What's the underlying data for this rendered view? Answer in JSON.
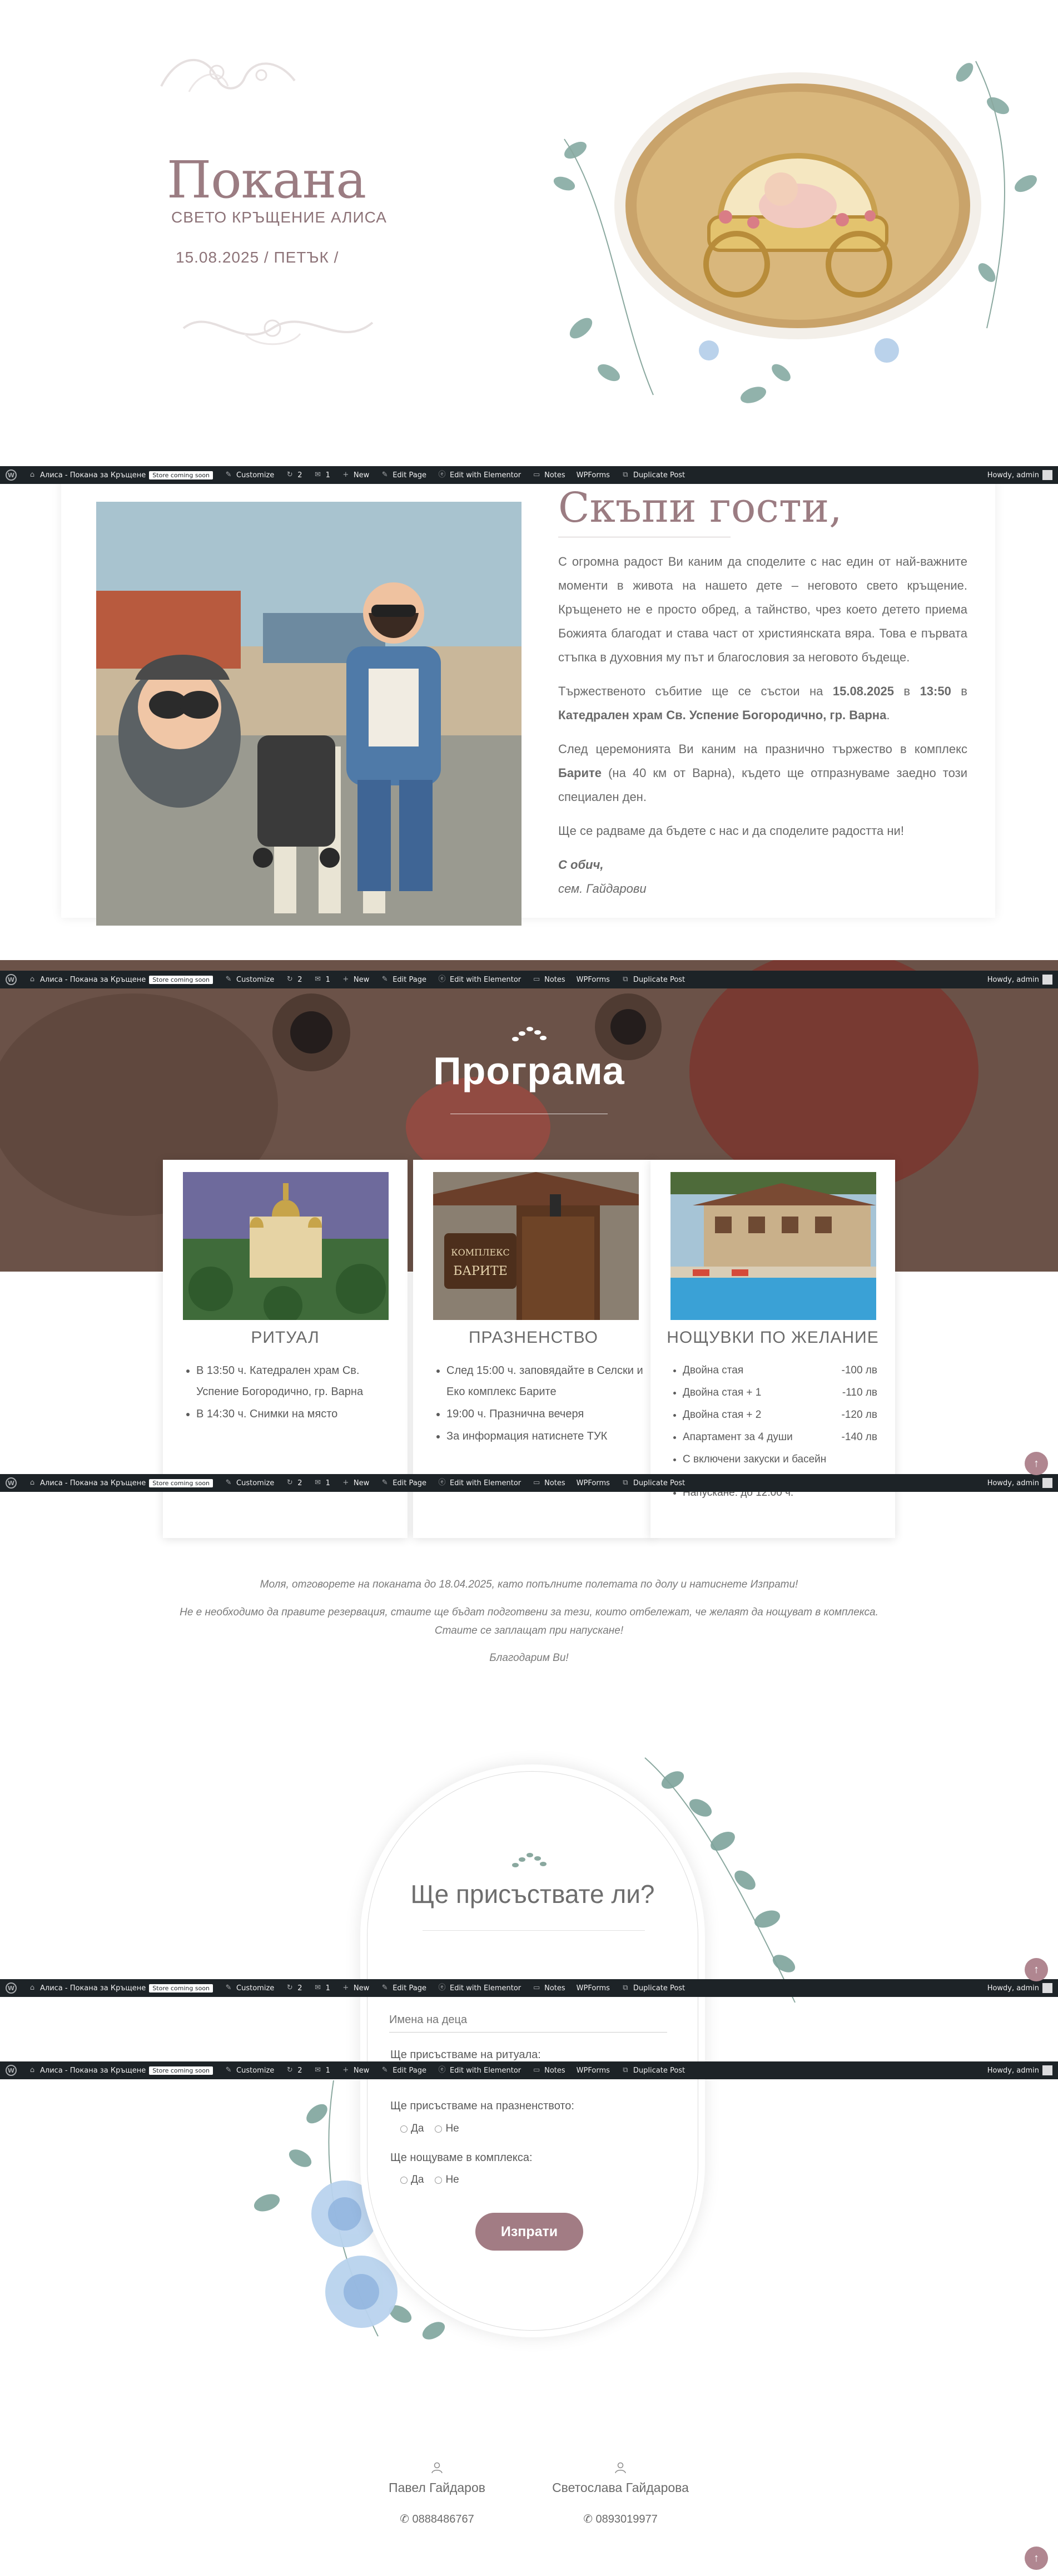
{
  "adminbar": {
    "site_name": "Алиса - Покана за Кръщене",
    "badge": "Store coming soon",
    "customize": "Customize",
    "updates": "2",
    "comments": "1",
    "new": "New",
    "edit_page": "Edit Page",
    "edit_elementor": "Edit with Elementor",
    "notes": "Notes",
    "wpforms": "WPForms",
    "duplicate": "Duplicate Post",
    "howdy": "Howdy, admin"
  },
  "hero": {
    "title": "Покана",
    "subtitle": "СВЕТО КРЪЩЕНИЕ АЛИСА",
    "date": "15.08.2025 / ПЕТЪК /"
  },
  "invite": {
    "title": "Скъпи гости,",
    "p1": "С огромна радост Ви каним да споделите с нас един от най-важните моменти в живота на нашето дете – неговото свето кръщение. Кръщенето не е просто обред, а тайнство, чрез което детето приема Божията благодат и става част от християнската вяра. Това е първата стъпка в духовния му път и благословия за неговото бъдеще.",
    "p2_a": "Тържественото събитие ще се състои на ",
    "p2_date": "15.08.2025",
    "p2_b": " в ",
    "p2_time": "13:50",
    "p2_c": " в ",
    "p2_place": "Катедрален храм Св. Успение Богородично, гр. Варна",
    "p2_d": ".",
    "p3_a": "След церемонията Ви каним на празнично тържество в комплекс ",
    "p3_place": "Барите",
    "p3_b": " (на 40 км от Варна), където ще отпразнуваме заедно този специален ден.",
    "p4": "Ще се радваме да бъдете с нас и да споделите радостта ни!",
    "sign1": "С обич,",
    "sign2": "сем. Гайдарови"
  },
  "program": {
    "title": "Програма",
    "cards": [
      {
        "title": "РИТУАЛ",
        "items": [
          "В 13:50 ч. Катедрален храм Св. Успение Богородично, гр. Варна",
          "В 14:30 ч. Снимки на място"
        ]
      },
      {
        "title": "ПРАЗНЕНСТВО",
        "items": [
          "След 15:00 ч. заповядайте в Селски и Еко комплекс Барите",
          "19:00 ч. Празнична вечеря",
          "За информация натиснете ТУК"
        ]
      },
      {
        "title": "НОЩУВКИ ПО ЖЕЛАНИЕ",
        "prices": [
          {
            "label": "Двойна стая",
            "price": "-100 лв"
          },
          {
            "label": "Двойна стая + 1",
            "price": "-110 лв"
          },
          {
            "label": "Двойна стая + 2",
            "price": "-120 лв"
          },
          {
            "label": "Апартамент за 4 души",
            "price": "-140 лв"
          }
        ],
        "extra1": "С включени закуски и басейн",
        "extra2": "Напускане: до 12:00 ч."
      }
    ],
    "sign_text": "КОМПЛЕКС БАРИТЕ"
  },
  "rsvp_intro": {
    "line1": "Моля, отговорете на поканата до 18.04.2025, като попълните полетата по долу и натиснете Изпрати!",
    "line2": "Не е необходимо да правите резервация, стаите ще бъдат подготвени за тези, които отбележат, че желаят да нощуват в комплекса. Стаите се заплащат при напускане!",
    "line3": "Благодарим Ви!"
  },
  "rsvp_form": {
    "title": "Ще присъствате ли?",
    "children_placeholder": "Имена на деца",
    "q_ritual": "Ще присъстваме на ритуала:",
    "q_party": "Ще присъстваме на празненството:",
    "q_stay": "Ще нощуваме в комплекса:",
    "yes": "Да",
    "no": "Не",
    "submit": "Изпрати"
  },
  "contacts": [
    {
      "name": "Павел Гайдаров",
      "phone": "0888486767"
    },
    {
      "name": "Светослава Гайдарова",
      "phone": "0893019977"
    }
  ],
  "colors": {
    "accent": "#9b7c82",
    "button": "#a27c84",
    "adminbar": "#1d2327"
  },
  "icons": [
    "wordpress-icon",
    "customize-icon",
    "updates-icon",
    "comments-icon",
    "plus-icon",
    "edit-icon",
    "elementor-icon",
    "notes-icon",
    "duplicate-icon",
    "person-icon",
    "phone-icon",
    "arrow-up-icon",
    "leaf-icon"
  ]
}
